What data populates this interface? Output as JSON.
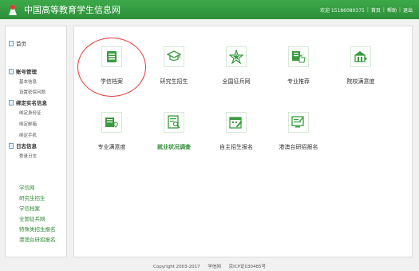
{
  "header": {
    "title": "中国高等教育学生信息网",
    "welcome": "欢迎 15186080375",
    "links": [
      "首页",
      "帮助",
      "退出"
    ]
  },
  "sidebar": {
    "home": "首页",
    "account": {
      "heading": "账号管理",
      "items": [
        "基本信息",
        "设置密保问题"
      ]
    },
    "realname": {
      "heading": "绑定实名信息",
      "items": [
        "绑定身份证",
        "绑定邮箱",
        "绑定手机"
      ]
    },
    "log": {
      "heading": "日志信息",
      "items": [
        "登录日志"
      ]
    },
    "links": [
      "学信网",
      "研究生招生",
      "学信档案",
      "全国征兵网",
      "特殊类招生报名",
      "港澳台研招报名"
    ]
  },
  "tiles": [
    {
      "label": "学信档案",
      "icon": "archive-icon"
    },
    {
      "label": "研究生招生",
      "icon": "graduate-cap-icon"
    },
    {
      "label": "全国征兵网",
      "icon": "star-icon"
    },
    {
      "label": "专业推荐",
      "icon": "recommend-icon"
    },
    {
      "label": "院校满意度",
      "icon": "school-rating-icon"
    },
    {
      "label": "专业满意度",
      "icon": "major-rating-icon"
    },
    {
      "label": "就业状况调查",
      "icon": "survey-icon"
    },
    {
      "label": "自主招生报名",
      "icon": "calendar-icon"
    },
    {
      "label": "港澳台研招报名",
      "icon": "form-icon"
    }
  ],
  "footer": {
    "copyright": "Copyright 2003-2017",
    "site": "学信网",
    "icp": "京ICP证030485号"
  },
  "colors": {
    "brand_green": "#2f8a34",
    "header_green": "#3da94a",
    "highlight_circle": "#e53935"
  }
}
